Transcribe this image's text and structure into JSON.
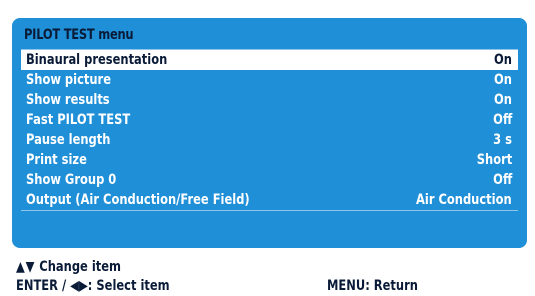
{
  "panel": {
    "title": "PILOT TEST menu"
  },
  "menu": {
    "selected_index": 0,
    "items": [
      {
        "label": "Binaural presentation",
        "value": "On"
      },
      {
        "label": "Show picture",
        "value": "On"
      },
      {
        "label": "Show results",
        "value": "On"
      },
      {
        "label": "Fast PILOT TEST",
        "value": "Off"
      },
      {
        "label": "Pause length",
        "value": "3 s"
      },
      {
        "label": "Print size",
        "value": "Short"
      },
      {
        "label": "Show Group 0",
        "value": "Off"
      },
      {
        "label": "Output (Air Conduction/Free Field)",
        "value": "Air Conduction"
      }
    ]
  },
  "footer": {
    "change_glyphs": "▲▼",
    "change_text": " Change item",
    "select_text": "ENTER / ◀▶: Select item",
    "return_text": "MENU: Return"
  },
  "colors": {
    "panel": "#1f8fd8",
    "selected_row": "#ffffff",
    "text_dark": "#0a1b38",
    "text_light": "#ffffff"
  }
}
